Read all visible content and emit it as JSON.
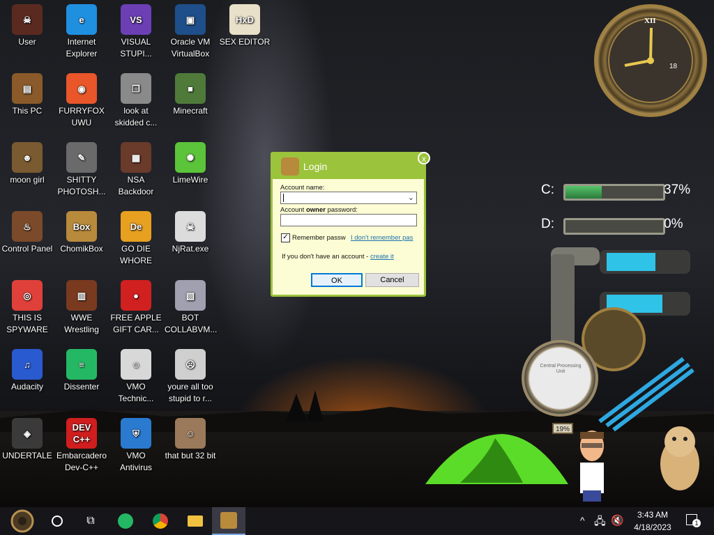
{
  "desktop_icons": [
    {
      "label": "User",
      "glyph": "☠",
      "bg": "#5a2a20"
    },
    {
      "label": "Internet Explorer",
      "glyph": "e",
      "bg": "#1f8fe0"
    },
    {
      "label": "VISUAL STUPI...",
      "glyph": "VS",
      "bg": "#6c3fb5"
    },
    {
      "label": "Oracle VM VirtualBox",
      "glyph": "▣",
      "bg": "#1e4f8a"
    },
    {
      "label": "SEX EDITOR",
      "glyph": "HxD",
      "bg": "#e8e0c8"
    },
    {
      "label": "This PC",
      "glyph": "▤",
      "bg": "#8a5a2a"
    },
    {
      "label": "FURRYFOX UWU",
      "glyph": "◉",
      "bg": "#e8562a"
    },
    {
      "label": "look at skidded c...",
      "glyph": "❐",
      "bg": "#8a8a8a"
    },
    {
      "label": "Minecraft",
      "glyph": "■",
      "bg": "#4f7a3a"
    },
    {
      "label": "moon girl",
      "glyph": "☻",
      "bg": "#7a5a30"
    },
    {
      "label": "SHITTY PHOTOSH...",
      "glyph": "✎",
      "bg": "#6a6a6a"
    },
    {
      "label": "NSA Backdoor",
      "glyph": "▦",
      "bg": "#6a3a2a"
    },
    {
      "label": "LimeWire",
      "glyph": "✺",
      "bg": "#5cc43a"
    },
    {
      "label": "Control Panel",
      "glyph": "♨",
      "bg": "#7a4a2a"
    },
    {
      "label": "ChomikBox",
      "glyph": "Box",
      "bg": "#b88a3c"
    },
    {
      "label": "GO DIE WHORE",
      "glyph": "De",
      "bg": "#e8a020"
    },
    {
      "label": "NjRat.exe",
      "glyph": "☠",
      "bg": "#dcdcdc"
    },
    {
      "label": "THIS IS SPYWARE",
      "glyph": "◎",
      "bg": "#e0403a"
    },
    {
      "label": "WWE Wrestling",
      "glyph": "▥",
      "bg": "#7a3a20"
    },
    {
      "label": "FREE APPLE GIFT CAR...",
      "glyph": "●",
      "bg": "#d02020"
    },
    {
      "label": "BOT COLLABVM...",
      "glyph": "▧",
      "bg": "#a0a0b0"
    },
    {
      "label": "Audacity",
      "glyph": "♫",
      "bg": "#2a5ad0"
    },
    {
      "label": "Dissenter",
      "glyph": "≡",
      "bg": "#25b864"
    },
    {
      "label": "VMO Technic...",
      "glyph": "☺",
      "bg": "#d8d8d8"
    },
    {
      "label": "youre all too stupid to r...",
      "glyph": "☹",
      "bg": "#cfcfcf"
    },
    {
      "label": "UNDERTALE",
      "glyph": "◈",
      "bg": "#3a3a3a"
    },
    {
      "label": "Embarcadero Dev-C++",
      "glyph": "DEV C++",
      "bg": "#d01e1e"
    },
    {
      "label": "VMO Antivirus",
      "glyph": "⛨",
      "bg": "#2a7ad0"
    },
    {
      "label": "that but 32 bit",
      "glyph": "☺",
      "bg": "#9a7a5a"
    }
  ],
  "clock": {
    "numeral_top": "XII",
    "day": "18"
  },
  "drives": [
    {
      "label": "C:",
      "percent": "37%",
      "fill": 0.37
    },
    {
      "label": "D:",
      "percent": "0%",
      "fill": 0.0
    }
  ],
  "gauge": {
    "title": "Central Processing Unit",
    "value": "19%"
  },
  "login": {
    "title": "Login",
    "account_label": "Account name:",
    "password_label_pre": "Account ",
    "password_label_bold": "owner",
    "password_label_post": " password:",
    "account_value": "",
    "password_value": "",
    "remember_label": "Remember passw",
    "remember_checked": true,
    "forgot_link": "I don't remember pas",
    "no_account_text": "If you don't have an account - ",
    "create_link": "create it",
    "ok_label": "OK",
    "cancel_label": "Cancel",
    "close_glyph": "x"
  },
  "taskbar": {
    "time": "3:43 AM",
    "date": "4/18/2023",
    "notification_count": "1"
  }
}
